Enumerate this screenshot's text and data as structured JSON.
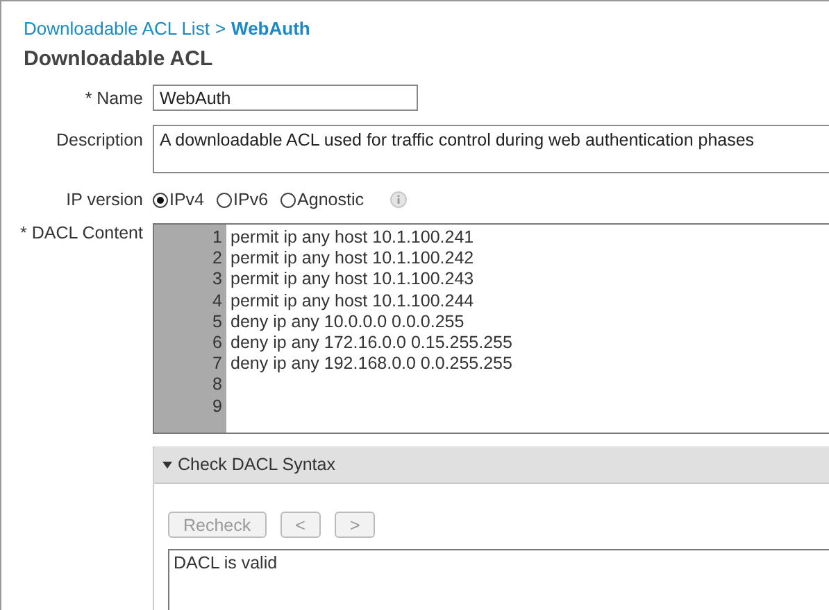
{
  "breadcrumb": {
    "parent": "Downloadable ACL List",
    "separator": ">",
    "current": "WebAuth"
  },
  "title": "Downloadable ACL",
  "name": {
    "label": "* Name",
    "value": "WebAuth"
  },
  "description": {
    "label": "Description",
    "value": "A downloadable ACL used for traffic control during web authentication phases"
  },
  "ip_version": {
    "label": "IP version",
    "options": [
      {
        "label": "IPv4",
        "selected": true
      },
      {
        "label": "IPv6",
        "selected": false
      },
      {
        "label": "Agnostic",
        "selected": false
      }
    ]
  },
  "dacl_content": {
    "label": "* DACL Content",
    "lines": [
      {
        "number": "1",
        "text": "permit ip any host 10.1.100.241"
      },
      {
        "number": "2",
        "text": "permit ip any host 10.1.100.242"
      },
      {
        "number": "3",
        "text": "permit ip any host 10.1.100.243"
      },
      {
        "number": "4",
        "text": "permit ip any host 10.1.100.244"
      },
      {
        "number": "5",
        "text": "deny ip any 10.0.0.0 0.0.0.255"
      },
      {
        "number": "6",
        "text": "deny ip any 172.16.0.0 0.15.255.255"
      },
      {
        "number": "7",
        "text": "deny ip any 192.168.0.0 0.0.255.255"
      },
      {
        "number": "8"
      },
      {
        "number": "9"
      }
    ]
  },
  "syntax_check": {
    "title": "Check DACL Syntax",
    "expanded": true,
    "buttons": [
      {
        "label": "Recheck",
        "disabled": true
      },
      {
        "label": "<",
        "disabled": true
      },
      {
        "label": ">",
        "disabled": true
      }
    ],
    "result": "DACL is valid"
  }
}
